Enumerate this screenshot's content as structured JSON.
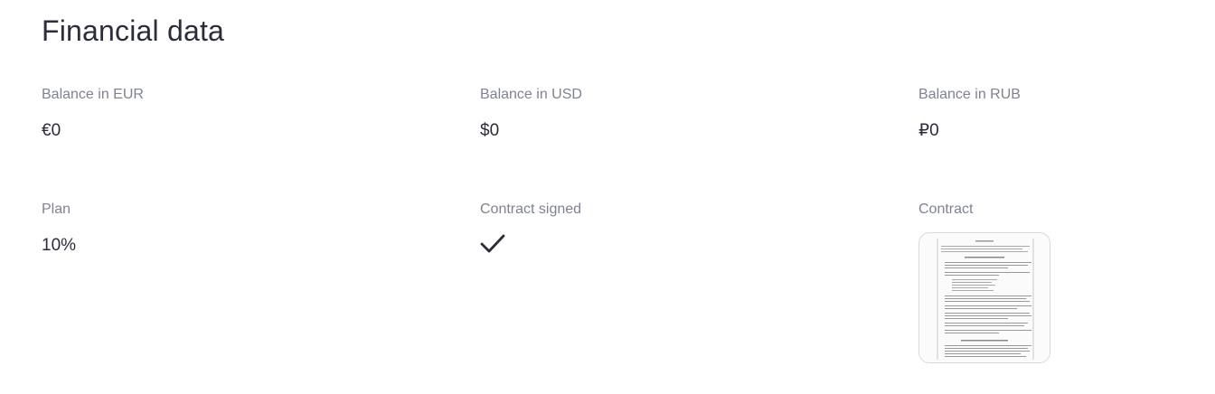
{
  "page": {
    "title": "Financial data"
  },
  "fields": {
    "balance_eur": {
      "label": "Balance in EUR",
      "value": "€0"
    },
    "balance_usd": {
      "label": "Balance in USD",
      "value": "$0"
    },
    "balance_rub": {
      "label": "Balance in RUB",
      "value": "₽0"
    },
    "plan": {
      "label": "Plan",
      "value": "10%"
    },
    "contract_signed": {
      "label": "Contract signed",
      "value": true,
      "icon": "checkmark-icon"
    },
    "contract": {
      "label": "Contract",
      "icon": "document-thumbnail"
    }
  }
}
